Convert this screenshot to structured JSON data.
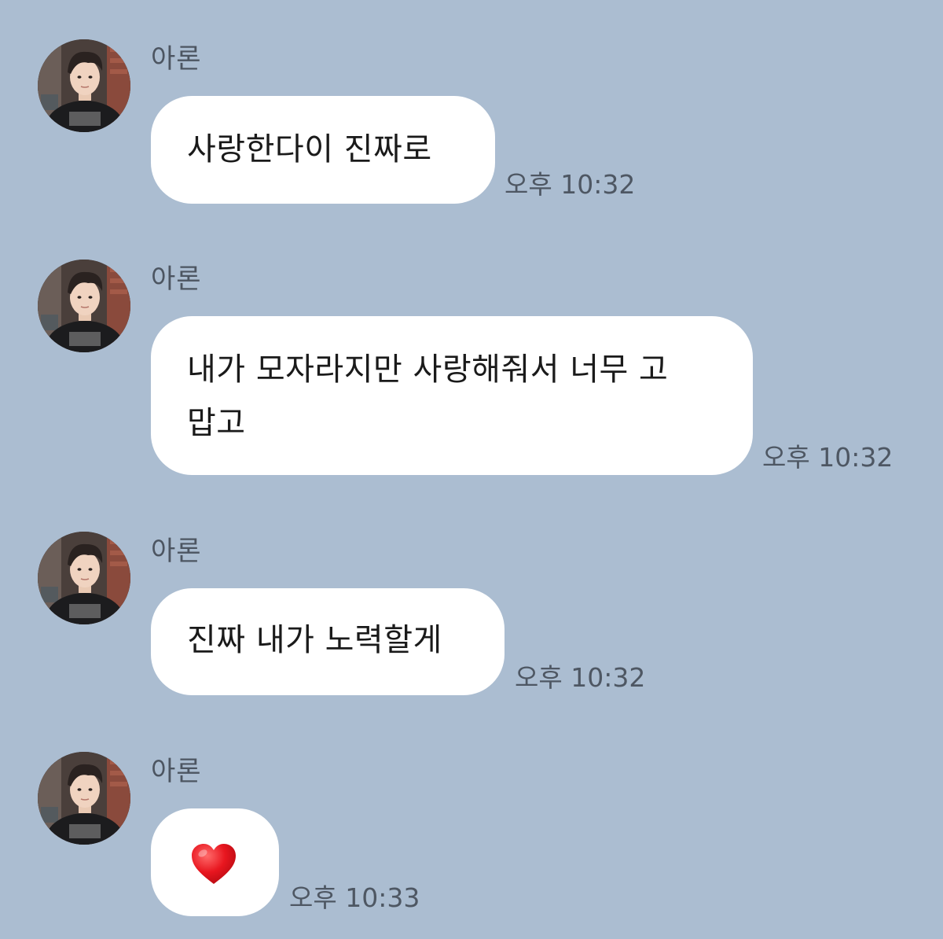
{
  "sender_name": "아론",
  "messages": [
    {
      "text": "사랑한다이 진짜로",
      "time": "오후 10:32"
    },
    {
      "text": "내가 모자라지만 사랑해줘서 너무 고\n맙고",
      "time": "오후 10:32"
    },
    {
      "text": "진짜 내가 노력할게",
      "time": "오후 10:32"
    },
    {
      "text": "❤️",
      "time": "오후 10:33",
      "emoji": "heart-icon"
    }
  ],
  "colors": {
    "background": "#abbdd1",
    "bubble": "#ffffff",
    "text": "#1a1a1a",
    "meta": "#4e5763",
    "heart": "#e0141e"
  }
}
